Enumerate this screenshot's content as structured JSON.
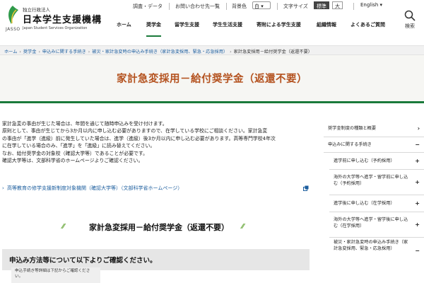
{
  "header": {
    "org_sub": "独立行政法人",
    "org_name": "日本学生支援機構",
    "org_en": "Japan Student Services Organization",
    "org_abbr": "JASSO",
    "util_links": [
      "調査・データ",
      "お問い合わせ先一覧"
    ],
    "bg_label": "背景色",
    "bg_value": "白",
    "text_size_label": "文字サイズ",
    "text_size_options": [
      "標準",
      "大"
    ],
    "text_size_selected": "標準",
    "language": "English",
    "nav": [
      "ホーム",
      "奨学金",
      "留学生支援",
      "学生生活支援",
      "寄附による学生支援",
      "組織情報",
      "よくあるご質問"
    ],
    "nav_active": "奨学金",
    "search_label": "検索",
    "brand_color": "#1b7a3b"
  },
  "breadcrumb": [
    "ホーム",
    "奨学金",
    "申込みに関する手続き",
    "被災・家計急変時の申込み手続き（家計急変採用、緊急・応急採用）",
    "家計急変採用－給付奨学金（返還不要）"
  ],
  "page_title": "家計急変採用－給付奨学金（返還不要）",
  "intro_lines": [
    "家計急変の事由が生じた場合は、年間を通じて随時申込みを受け付けます。",
    "原則として、事由が生じてから3か月以内に申し込む必要がありますので、在学している学校にご相談ください。家計急変",
    "の事由が「進学（進級）前に発生していた場合は、進学（進級）後3か月以内に申し込む必要があります。高等専門学校4年次",
    "に在学している場合のみ、「進学」を「進級」に読み替えてください。",
    "なお、給付奨学金の対象校（確認大学等）であることが必要です。",
    "確認大学等は、文部科学省のホームページよりご確認ください。"
  ],
  "external_link": "高等教育の修学支援新制度対象機関（確認大学等）（文部科学省ホームページ）",
  "section_heading": "家計急変採用－給付奨学金（返還不要）",
  "info_box": "申込み方法等について以下よりご確認ください。",
  "sidebar": {
    "items": [
      {
        "label": "奨学金制度の種類と概要",
        "mark": "›",
        "sub": false
      },
      {
        "label": "申込みに関する手続き",
        "mark": "−",
        "sub": false
      },
      {
        "label": "進学前に申し込む（予約採用）",
        "mark": "+",
        "sub": true
      },
      {
        "label": "海外の大学等へ進学・留学前に申し込む（予約採用）",
        "mark": "+",
        "sub": true
      },
      {
        "label": "進学後に申し込む（在学採用）",
        "mark": "+",
        "sub": true
      },
      {
        "label": "海外の大学等へ進学・留学後に申し込む（在学採用）",
        "mark": "+",
        "sub": true
      },
      {
        "label": "被災・家計急変時の申込み手続き（家計急変採用、緊急・応急採用）",
        "mark": "−",
        "sub": true
      }
    ],
    "note": "申込手続き等詳細は下記からご確認ください。"
  }
}
